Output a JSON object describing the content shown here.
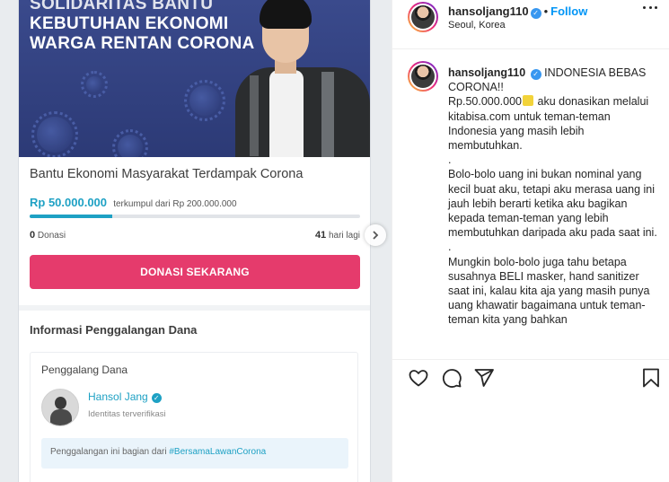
{
  "post_image": {
    "banner_line1": "SOLIDARITAS BANTU",
    "banner_line2_prefix": "KEBUTUHAN ",
    "banner_line2_bold": "EKONOMI",
    "banner_line3": "WARGA RENTAN CORONA",
    "campaign_title": "Bantu Ekonomi Masyarakat Terdampak Corona",
    "amount": "Rp 50.000.000",
    "amount_rest": "terkumpul dari Rp 200.000.000",
    "progress_fraction": 0.25,
    "donations_count": "0",
    "donations_label": "Donasi",
    "days_count": "41",
    "days_label": "hari lagi",
    "donate_button": "DONASI SEKARANG",
    "info_heading": "Informasi Penggalangan Dana",
    "fund_heading": "Penggalang Dana",
    "fund_name": "Hansol Jang",
    "fund_sub": "Identitas terverifikasi",
    "fund_note_prefix": "Penggalangan ini bagian dari ",
    "fund_note_tag": "#BersamaLawanCorona"
  },
  "header": {
    "username": "hansoljang110",
    "follow_label": "Follow",
    "location": "Seoul, Korea"
  },
  "caption": {
    "username": "hansoljang110",
    "p1": "INDONESIA BEBAS CORONA!!",
    "p2a": "Rp.50.000.000",
    "p2b": " aku donasikan melalui kitabisa.com untuk teman-teman Indonesia yang masih lebih membutuhkan.",
    "dot1": ".",
    "p3": "Bolo-bolo uang ini bukan nominal yang kecil buat aku, tetapi aku merasa uang ini jauh lebih berarti ketika aku bagikan kepada teman-teman yang lebih membutuhkan daripada aku pada saat ini.",
    "dot2": ".",
    "p4": "Mungkin bolo-bolo juga tahu betapa susahnya BELI masker, hand sanitizer saat ini, kalau kita aja yang masih punya uang khawatir bagaimana untuk teman-teman kita yang bahkan"
  },
  "icons": {
    "like": "heart-icon",
    "comment": "comment-icon",
    "share": "share-icon",
    "save": "bookmark-icon",
    "more": "more-icon",
    "next": "chevron-right-icon"
  },
  "colors": {
    "kitabisa_blue": "#1ea1c4",
    "donate_pink": "#e53b6c",
    "ig_blue": "#0095f6"
  }
}
